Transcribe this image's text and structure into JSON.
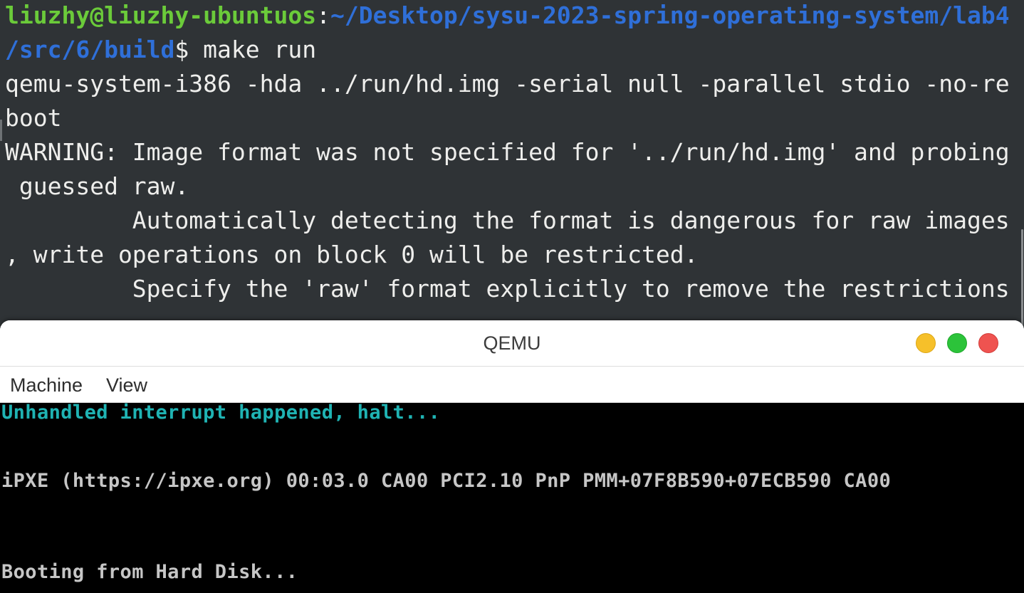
{
  "terminal": {
    "prompt": {
      "user_host": "liuzhy@liuzhy-ubuntuos",
      "separator": ":",
      "path_part1": "~/Desktop/sysu-2023-spring-operating-system/lab4",
      "path_part2": "/src/6/build",
      "symbol": "$",
      "command": " make run"
    },
    "output_lines": [
      "qemu-system-i386 -hda ../run/hd.img -serial null -parallel stdio -no-re",
      "boot",
      "WARNING: Image format was not specified for '../run/hd.img' and probing",
      " guessed raw.",
      "         Automatically detecting the format is dangerous for raw images",
      ", write operations on block 0 will be restricted.",
      "         Specify the 'raw' format explicitly to remove the restrictions"
    ],
    "colors": {
      "user_host": "#6bcb3a",
      "path": "#2f6fd8",
      "text": "#eeeeec",
      "background": "#2f3336"
    }
  },
  "qemu_window": {
    "title": "QEMU",
    "buttons": {
      "minimize": "minimize",
      "maximize": "maximize",
      "close": "close"
    },
    "menu": {
      "machine": "Machine",
      "view": "View"
    },
    "screen_lines": {
      "interrupt": "Unhandled interrupt happened, halt...",
      "ipxe": "iPXE (https://ipxe.org) 00:03.0 CA00 PCI2.10 PnP PMM+07F8B590+07ECB590 CA00",
      "boot": "Booting from Hard Disk..."
    },
    "colors": {
      "interrupt_text": "#1fb3b3",
      "vga_text": "#c6c6c6",
      "close_button": "#ef5350",
      "maximize_button": "#2cc33a",
      "minimize_button": "#f6c02a"
    }
  }
}
